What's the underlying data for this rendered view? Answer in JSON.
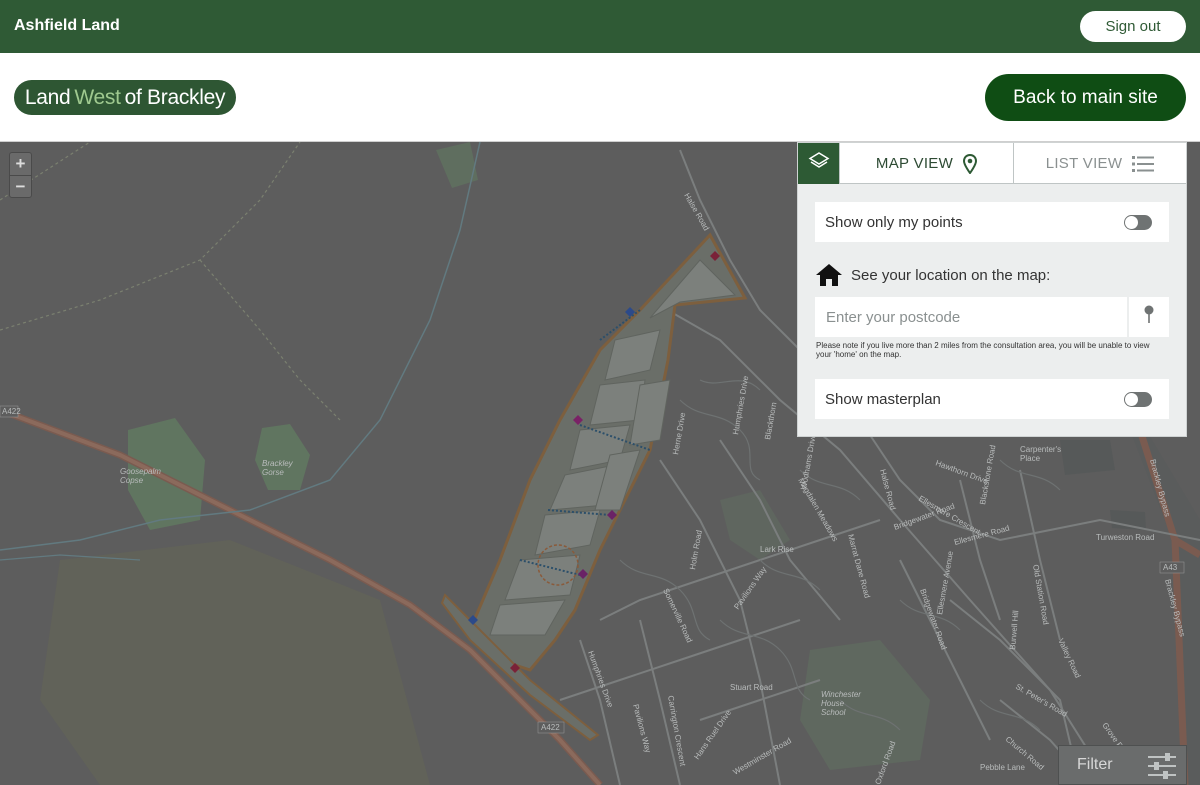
{
  "topbar": {
    "brand": "Ashfield Land",
    "signout_label": "Sign out"
  },
  "header": {
    "logo": {
      "part1": "Land",
      "part2": "West",
      "part3": "of Brackley"
    },
    "back_label": "Back to main site"
  },
  "map": {
    "zoom_in": "+",
    "zoom_out": "−",
    "labels": {
      "a422_left": "A422",
      "a422_bottom": "A422",
      "a43": "A43",
      "goosepalm": "Goosepalm\nCopse",
      "brackley_gorse": "Brackley\nGorse",
      "halse_road": "Halse Road",
      "herne_drive": "Herne Drive",
      "humphries_drive": "Humphries Drive",
      "blackthorn": "Blackthorn",
      "wodhams": "Wodhams Drive",
      "magdalen": "Magdalen Meadows",
      "halse_road2": "Halse Road",
      "hawthorn_drive": "Hawthorn Drive",
      "blackstone_road": "Blackstone Road",
      "carpenters_place": "Carpenter's\nPlace",
      "brackley_bypass": "Brackley Bypass",
      "brackley_bypass2": "Brackley Bypass",
      "turweston_road": "Turweston Road",
      "ellesmere_crescent": "Ellesmere Crescent",
      "bridgewater_road": "Bridgewater Road",
      "ellesmere_road": "Ellesmere Road",
      "ellesmere_avenue": "Ellesmere Avenue",
      "bridgewater_road2": "Bridgewater Road",
      "lark_rise": "Lark Rise",
      "pavilions_way": "Pavilions Way",
      "somerville_road": "Somerville Road",
      "merton_drive": "Marrat Dane Road",
      "old_station_road": "Old Station Road",
      "burwell_hill": "Burwell Hill",
      "valley_road": "Valley Road",
      "st_peters_road": "St. Peter's Road",
      "church_road": "Church Road",
      "winchester_house": "Winchester\nHouse\nSchool",
      "stuart_road": "Stuart Road",
      "humphries_drive2": "Humphries Drive",
      "pebble_lane": "Pebble Lane",
      "grove_rd": "Grove Ro",
      "pavilions_way2": "Pavilions Way",
      "carrington": "Carrington Crescent",
      "hans_road": "Hans Ruel Drive",
      "westminster": "Westminster Road",
      "oxford_road": "Oxford Road",
      "holm": "Holm Road"
    }
  },
  "panel": {
    "tab_map": "MAP VIEW",
    "tab_list": "LIST VIEW",
    "show_my_points": "Show only my points",
    "see_location": "See your location on the map:",
    "postcode_placeholder": "Enter your postcode",
    "note": "Please note if you live more than 2 miles from the consultation area, you will be unable to view your 'home' on the map.",
    "show_masterplan": "Show masterplan",
    "toggles": {
      "my_points": false,
      "masterplan": false
    }
  },
  "filter": {
    "label": "Filter"
  },
  "colors": {
    "brand_green": "#2f5a35",
    "button_green": "#0f4d14",
    "map_bg": "#5d5d5d"
  }
}
